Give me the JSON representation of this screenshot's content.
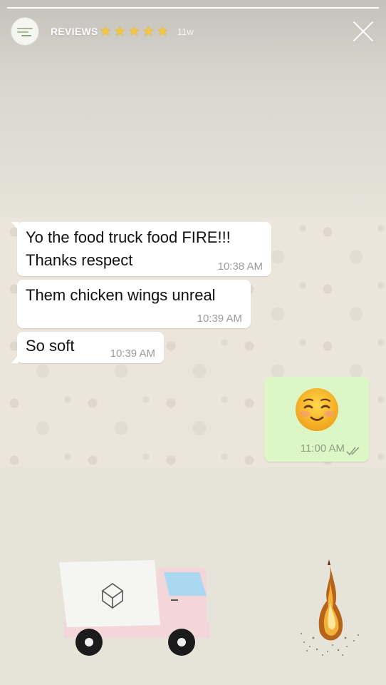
{
  "story": {
    "progress_fraction": 1.0,
    "account_name": "REVIEWS",
    "stars": [
      "★",
      "★",
      "★",
      "★",
      "★"
    ],
    "time_ago": "11w",
    "icons": {
      "close": "close-icon",
      "avatar": "avatar-logo",
      "stars": "star-icon"
    },
    "colors": {
      "star": "#f6c63d",
      "incoming_bubble": "#ffffff",
      "outgoing_bubble": "#dcf7c5"
    }
  },
  "chat": {
    "incoming": [
      {
        "line1": "Yo the food truck food FIRE!!!",
        "line2": "Thanks respect",
        "time": "10:38 AM"
      },
      {
        "text": "Them chicken wings unreal",
        "time": "10:39 AM"
      },
      {
        "text": "So soft",
        "time": "10:39 AM"
      }
    ],
    "outgoing": {
      "emoji": "smiling-face-icon",
      "time": "11:00 AM",
      "status": "read-ticks-icon"
    }
  },
  "stickers": {
    "truck": "food-truck-sticker",
    "fire": "fire-sticker"
  }
}
